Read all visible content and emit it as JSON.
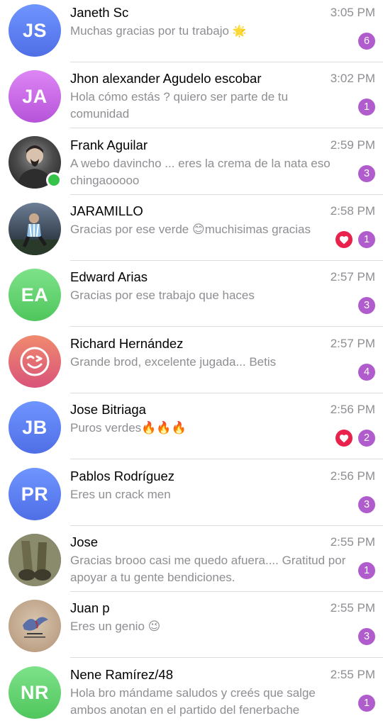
{
  "colors": {
    "badge": "#b05ccc",
    "heart": "#e8224b",
    "time": "#8e8e93",
    "preview": "#8e8e93",
    "online": "#36c34a"
  },
  "chats": [
    {
      "name": "Janeth Sc",
      "time": "3:05 PM",
      "message": "Muchas gracias por tu trabajo",
      "emoji": "🌟",
      "badge": "6",
      "initials": "JS",
      "avatar_color": "#5b7ef1",
      "heart": false
    },
    {
      "name": "Jhon alexander Agudelo escobar",
      "time": "3:02 PM",
      "message": "Hola cómo estás ? quiero ser parte de tu comunidad",
      "badge": "1",
      "initials": "JA",
      "avatar_color": "#c767e3",
      "heart": false
    },
    {
      "name": "Frank Aguilar",
      "time": "2:59 PM",
      "message": "A webo davincho ... eres la crema de la nata eso chingaooooo",
      "badge": "3",
      "initials": "",
      "avatar_color": "#3a3a3a",
      "online": true,
      "heart": false
    },
    {
      "name": "JARAMILLO",
      "time": "2:58 PM",
      "message": "Gracias por ese verde 😊muchisimas gracias",
      "badge": "1",
      "initials": "",
      "avatar_color": "#4a5a6a",
      "heart": true
    },
    {
      "name": "Edward Arias",
      "time": "2:57 PM",
      "message": "Gracias por ese trabajo que haces",
      "badge": "3",
      "initials": "EA",
      "avatar_color": "#5fd06a",
      "heart": false
    },
    {
      "name": "Richard Hernández",
      "time": "2:57 PM",
      "message": "Grande brod, excelente jugada... Betis",
      "badge": "4",
      "initials": "",
      "avatar_color": "#ec6a6a",
      "heart": false
    },
    {
      "name": "Jose Bitriaga",
      "time": "2:56 PM",
      "message": "Puros verdes🔥🔥🔥",
      "badge": "2",
      "initials": "JB",
      "avatar_color": "#5b7ef1",
      "heart": true
    },
    {
      "name": "Pablos Rodríguez",
      "time": "2:56 PM",
      "message": "Eres un crack men",
      "badge": "3",
      "initials": "PR",
      "avatar_color": "#5b7ef1",
      "heart": false
    },
    {
      "name": "Jose",
      "time": "2:55 PM",
      "message": "Gracias brooo casi me quedo afuera.... Gratitud por apoyar a tu gente bendiciones.",
      "badge": "1",
      "initials": "",
      "avatar_color": "#7d7a5e",
      "heart": false
    },
    {
      "name": "Juan p",
      "time": "2:55 PM",
      "message": "Eres un genio 😉",
      "badge": "3",
      "initials": "",
      "avatar_color": "#c9b39a",
      "heart": false
    },
    {
      "name": "Nene Ramírez/48",
      "time": "2:55 PM",
      "message": "Hola bro mándame saludos y creés que salge ambos anotan en el partido del fenerbache",
      "badge": "1",
      "initials": "NR",
      "avatar_color": "#5fd06a",
      "heart": false
    }
  ]
}
